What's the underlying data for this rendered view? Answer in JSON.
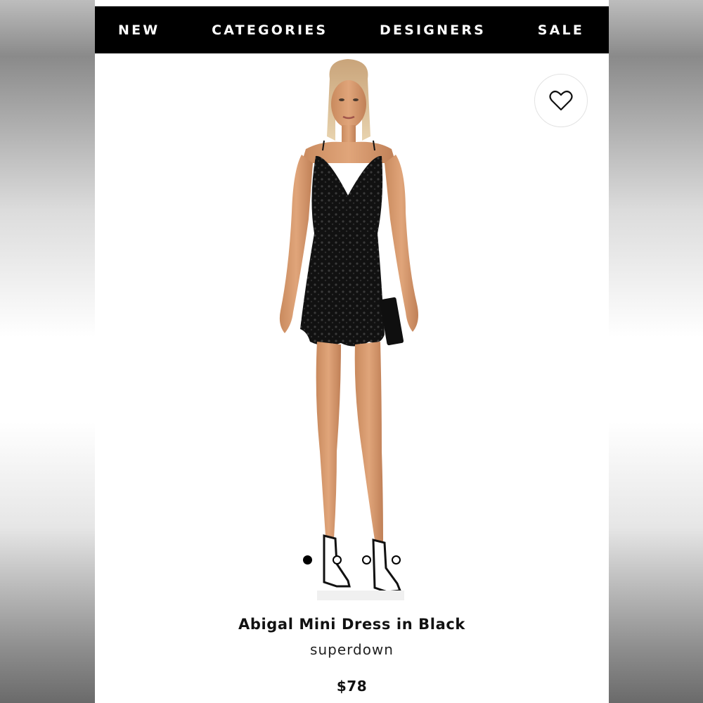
{
  "nav": {
    "items": [
      "NEW",
      "CATEGORIES",
      "DESIGNERS",
      "SALE"
    ]
  },
  "product": {
    "title": "Abigal Mini Dress in Black",
    "brand": "superdown",
    "price": "$78",
    "image_description_icon": "product-photo"
  },
  "carousel": {
    "total": 4,
    "active_index": 0
  },
  "favorite": {
    "icon": "heart-outline-icon"
  },
  "colors": {
    "nav_bg": "#000000",
    "nav_text": "#ffffff",
    "page_bg": "#ffffff"
  }
}
